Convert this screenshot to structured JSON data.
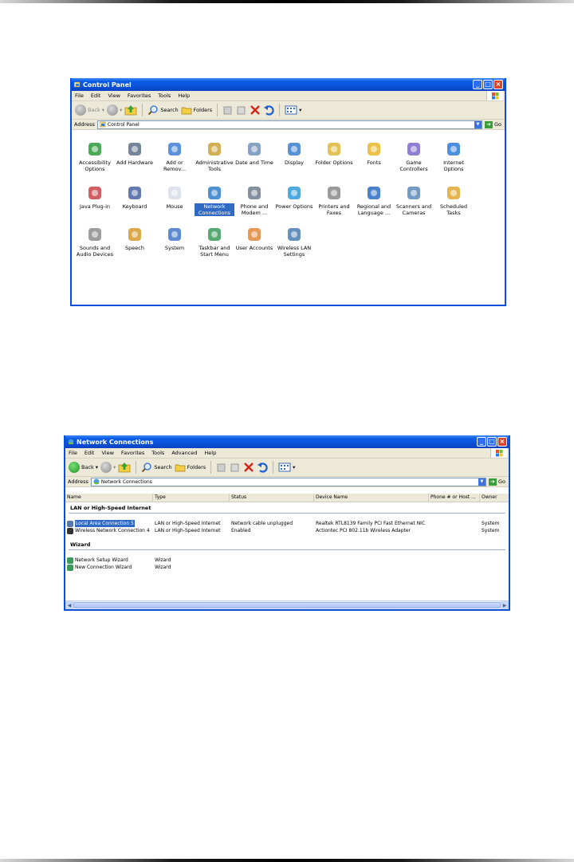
{
  "win1": {
    "title": "Control Panel",
    "menus": [
      "File",
      "Edit",
      "View",
      "Favorites",
      "Tools",
      "Help"
    ],
    "toolbar": {
      "back": "Back",
      "search": "Search",
      "folders": "Folders"
    },
    "address_label": "Address",
    "address_value": "Control Panel",
    "go": "Go",
    "items": [
      {
        "label": "Accessibility Options",
        "icon": "accessibility-icon"
      },
      {
        "label": "Add Hardware",
        "icon": "hardware-icon"
      },
      {
        "label": "Add or Remov...",
        "icon": "add-remove-icon"
      },
      {
        "label": "Administrative Tools",
        "icon": "admin-tools-icon"
      },
      {
        "label": "Date and Time",
        "icon": "clock-icon"
      },
      {
        "label": "Display",
        "icon": "display-icon"
      },
      {
        "label": "Folder Options",
        "icon": "folder-icon"
      },
      {
        "label": "Fonts",
        "icon": "fonts-icon"
      },
      {
        "label": "Game Controllers",
        "icon": "gamepad-icon"
      },
      {
        "label": "Internet Options",
        "icon": "globe-icon"
      },
      {
        "label": "Java Plug-in",
        "icon": "java-icon"
      },
      {
        "label": "Keyboard",
        "icon": "keyboard-icon"
      },
      {
        "label": "Mouse",
        "icon": "mouse-icon"
      },
      {
        "label": "Network Connections",
        "icon": "network-icon"
      },
      {
        "label": "Phone and Modem ...",
        "icon": "phone-icon"
      },
      {
        "label": "Power Options",
        "icon": "power-icon"
      },
      {
        "label": "Printers and Faxes",
        "icon": "printer-icon"
      },
      {
        "label": "Regional and Language ...",
        "icon": "globe-stand-icon"
      },
      {
        "label": "Scanners and Cameras",
        "icon": "scanner-icon"
      },
      {
        "label": "Scheduled Tasks",
        "icon": "tasks-icon"
      },
      {
        "label": "Sounds and Audio Devices",
        "icon": "speaker-icon"
      },
      {
        "label": "Speech",
        "icon": "speech-icon"
      },
      {
        "label": "System",
        "icon": "system-icon"
      },
      {
        "label": "Taskbar and Start Menu",
        "icon": "taskbar-icon"
      },
      {
        "label": "User Accounts",
        "icon": "users-icon"
      },
      {
        "label": "Wireless LAN Settings",
        "icon": "wireless-icon"
      }
    ],
    "selected": "Network Connections"
  },
  "win2": {
    "title": "Network Connections",
    "menus": [
      "File",
      "Edit",
      "View",
      "Favorites",
      "Tools",
      "Advanced",
      "Help"
    ],
    "toolbar": {
      "back": "Back",
      "search": "Search",
      "folders": "Folders"
    },
    "address_label": "Address",
    "address_value": "Network Connections",
    "go": "Go",
    "columns": [
      "Name",
      "Type",
      "Status",
      "Device Name",
      "Phone # or Host ...",
      "Owner"
    ],
    "groups": [
      {
        "title": "LAN or High-Speed Internet",
        "rows": [
          {
            "name": "Local Area Connection 5",
            "type": "LAN or High-Speed Internet",
            "status": "Network cable unplugged",
            "device": "Realtek RTL8139 Family PCI Fast Ethernet NIC",
            "phone": "",
            "owner": "System"
          },
          {
            "name": "Wireless Network Connection 4",
            "type": "LAN or High-Speed Internet",
            "status": "Enabled",
            "device": "Actiontec PCI 802.11b Wireless Adapter",
            "phone": "",
            "owner": "System"
          }
        ]
      },
      {
        "title": "Wizard",
        "rows": [
          {
            "name": "Network Setup Wizard",
            "type": "Wizard",
            "status": "",
            "device": "",
            "phone": "",
            "owner": ""
          },
          {
            "name": "New Connection Wizard",
            "type": "Wizard",
            "status": "",
            "device": "",
            "phone": "",
            "owner": ""
          }
        ]
      }
    ]
  },
  "colors": {
    "xp_blue": "#0a4fd6",
    "selection": "#316ac5",
    "chrome": "#ece9d8"
  }
}
